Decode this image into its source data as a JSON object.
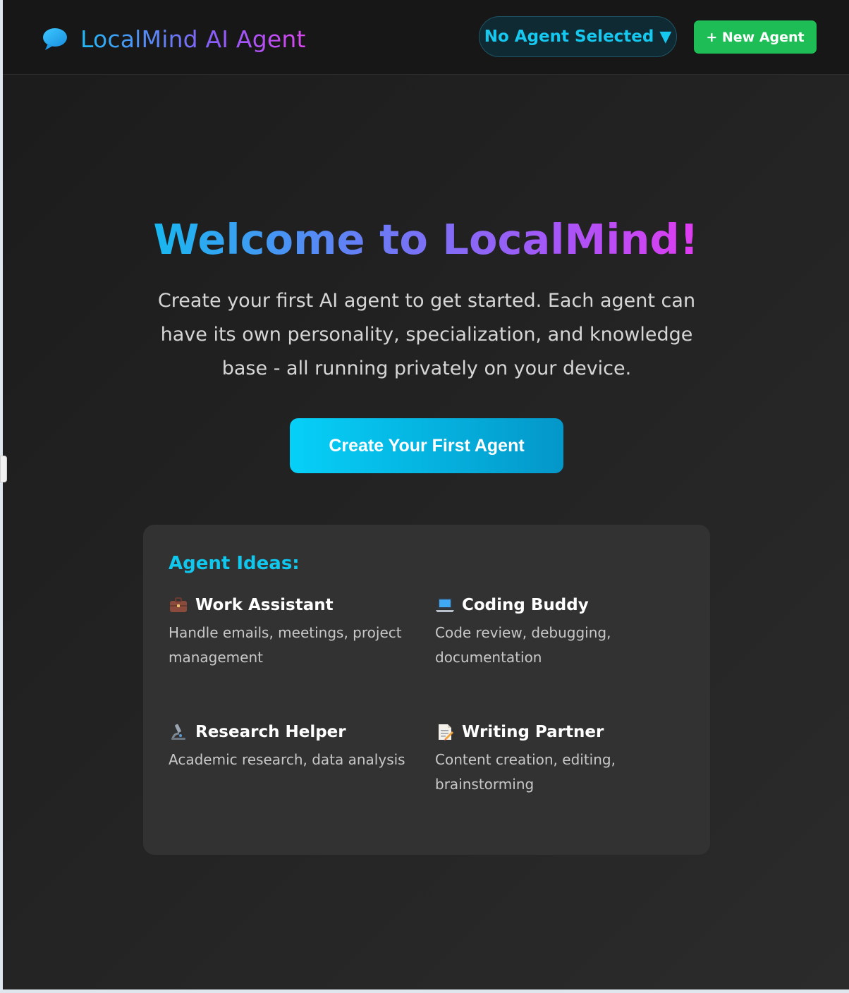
{
  "header": {
    "logo_text": "LocalMind AI Agent",
    "logo_icon": "speech-bubble-icon",
    "agent_select_label": "No Agent Selected",
    "agent_select_caret": "▼",
    "new_agent_label": "+ New Agent"
  },
  "welcome": {
    "title": "Welcome to LocalMind!",
    "description": "Create your first AI agent to get started. Each agent can have its own personality, specialization, and knowledge base - all running privately on your device.",
    "cta_label": "Create Your First Agent"
  },
  "ideas": {
    "title": "Agent Ideas:",
    "items": [
      {
        "icon": "briefcase-icon",
        "name": "Work Assistant",
        "desc": "Handle emails, meetings, project management"
      },
      {
        "icon": "laptop-icon",
        "name": "Coding Buddy",
        "desc": "Code review, debugging, documentation"
      },
      {
        "icon": "microscope-icon",
        "name": "Research Helper",
        "desc": "Academic research, data analysis"
      },
      {
        "icon": "memo-icon",
        "name": "Writing Partner",
        "desc": "Content creation, editing, brainstorming"
      }
    ]
  },
  "colors": {
    "accent_cyan": "#10c7ee",
    "new_agent_green": "#1fbd55",
    "gradient_start": "#18b8f0",
    "gradient_end": "#e03cf0"
  }
}
